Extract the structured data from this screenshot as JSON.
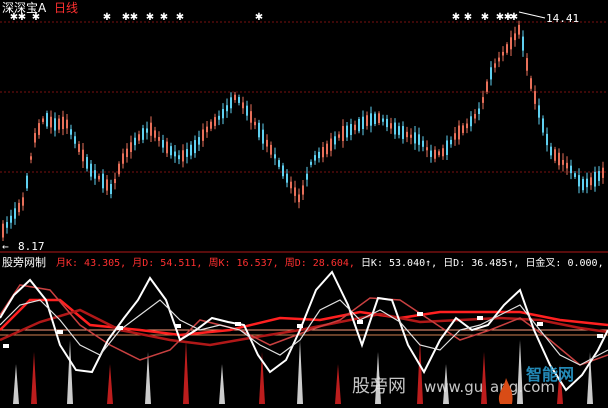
{
  "title_bar": {
    "symbol": "深深宝A",
    "period": "日线"
  },
  "price_panel": {
    "high_label": "14.41",
    "low_label": "8.17",
    "high_arrow": "←",
    "low_arrow": "←"
  },
  "indicator_panel": {
    "name": "股旁网制",
    "readouts": [
      {
        "label": "月K:",
        "value": "43.305,",
        "color": "#ff3030"
      },
      {
        "label": "月D:",
        "value": "54.511,",
        "color": "#ff3030"
      },
      {
        "label": "周K:",
        "value": "16.537,",
        "color": "#ff3030"
      },
      {
        "label": "周D:",
        "value": "28.604,",
        "color": "#ff3030"
      },
      {
        "label": "日K:",
        "value": "53.040↑,",
        "color": "#ffffff"
      },
      {
        "label": "日D:",
        "value": "36.485↑,",
        "color": "#ffffff"
      },
      {
        "label": "日金叉:",
        "value": "0.000,",
        "color": "#ffffff"
      }
    ]
  },
  "watermark": {
    "text1": "股旁网",
    "text2": "www.gu",
    "text3": "ang.com",
    "brand": "智能网"
  },
  "colors": {
    "background": "#000000",
    "up_candle": "#e8705a",
    "down_candle": "#5fd0f0",
    "grid": "#7a1010",
    "signal_star": "#ffffff",
    "month_line": "#ff2020",
    "week_line": "#c84040",
    "day_k_line": "#ffffff",
    "day_d_line": "#e0e0e0",
    "baseline": "#d08050"
  },
  "icons": {
    "signal_marker": "star-icon",
    "crosshair": "marker-icon"
  }
}
